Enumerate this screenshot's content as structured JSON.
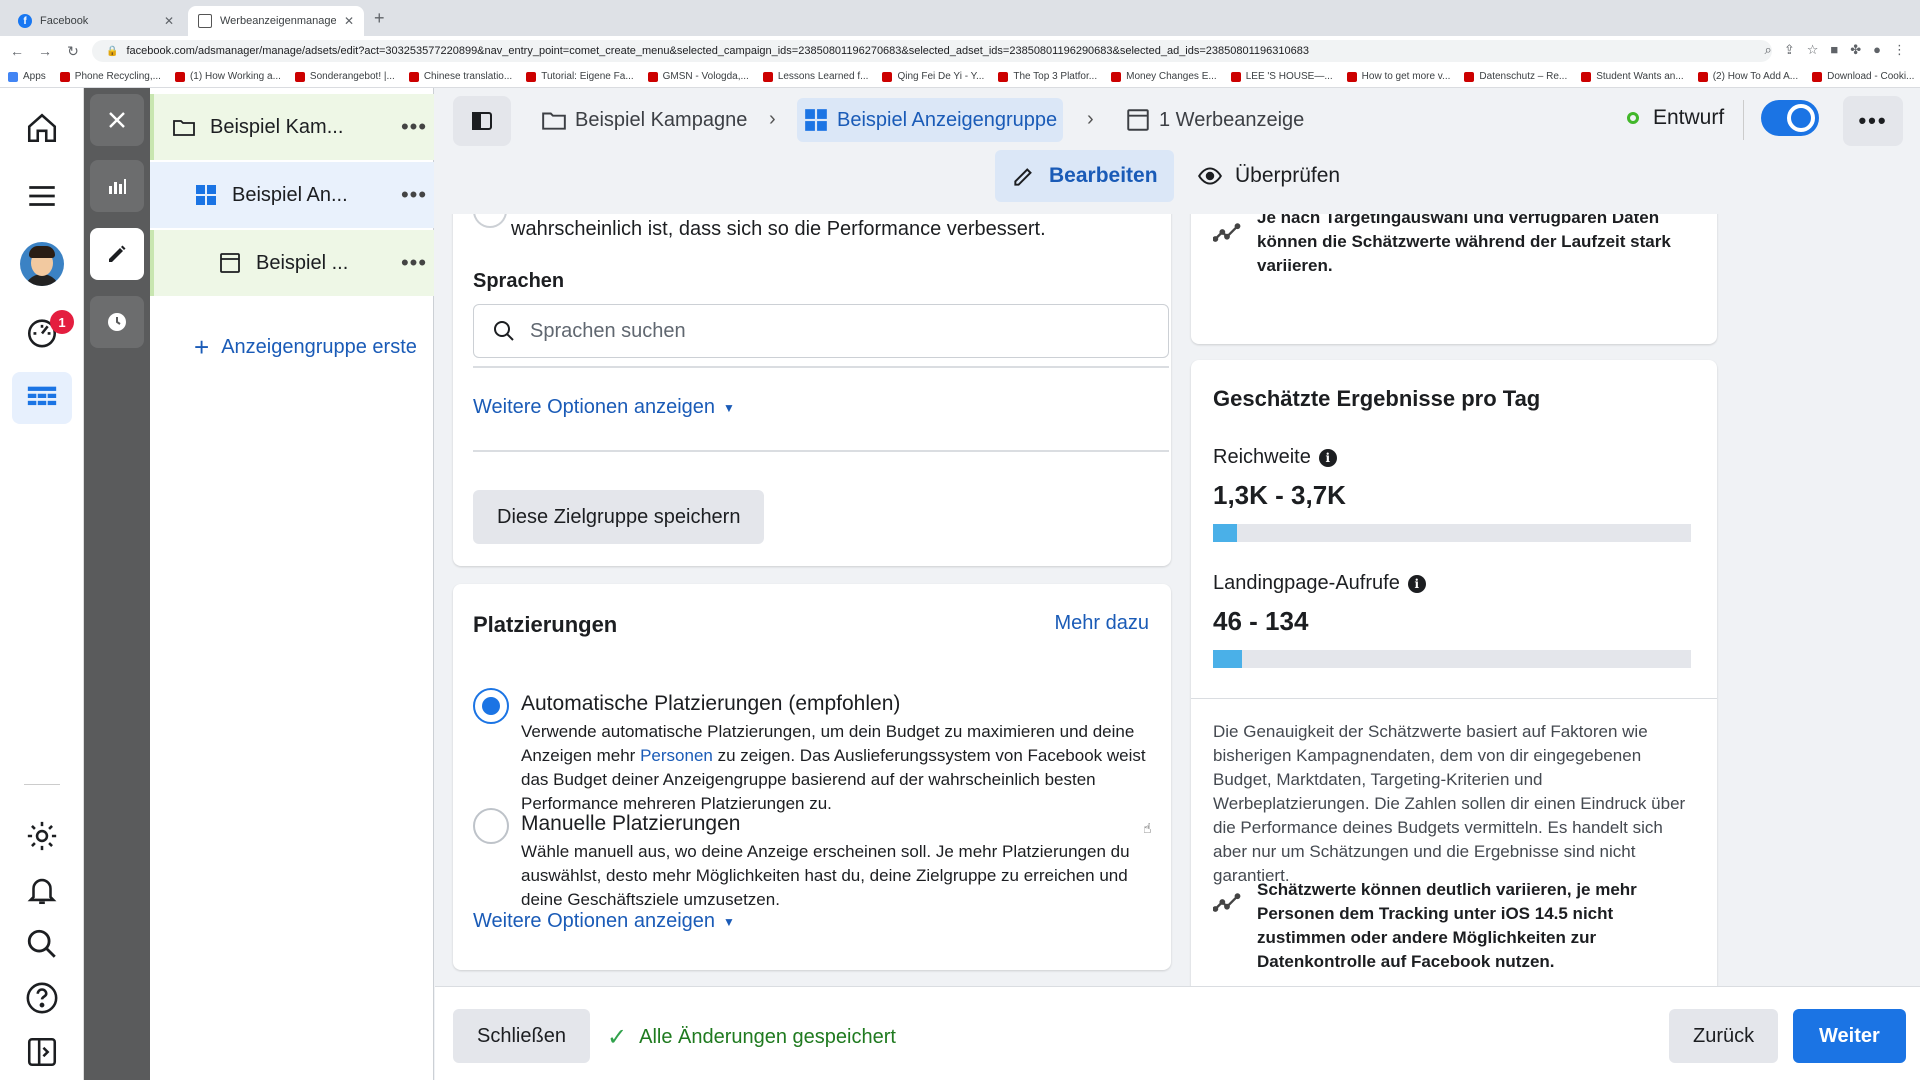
{
  "browser": {
    "tabs": [
      {
        "title": "Facebook",
        "active": false
      },
      {
        "title": "Werbeanzeigenmanager - Wer",
        "active": true
      }
    ],
    "url": "facebook.com/adsmanager/manage/adsets/edit?act=303253577220899&nav_entry_point=comet_create_menu&selected_campaign_ids=23850801196270683&selected_adset_ids=23850801196290683&selected_ad_ids=23850801196310683",
    "bookmarks": [
      "Apps",
      "Phone Recycling,...",
      "(1) How Working a...",
      "Sonderangebot! |...",
      "Chinese translatio...",
      "Tutorial: Eigene Fa...",
      "GMSN - Vologda,...",
      "Lessons Learned f...",
      "Qing Fei De Yi - Y...",
      "The Top 3 Platfor...",
      "Money Changes E...",
      "LEE 'S HOUSE—...",
      "How to get more v...",
      "Datenschutz – Re...",
      "Student Wants an...",
      "(2) How To Add A...",
      "Download - Cooki..."
    ]
  },
  "rail": {
    "notification_count": "1"
  },
  "tree": {
    "campaign": "Beispiel Kam...",
    "adset": "Beispiel An...",
    "ad": "Beispiel ...",
    "more": "•••",
    "create_adset": "Anzeigengruppe erste"
  },
  "topbar": {
    "crumb_campaign": "Beispiel Kampagne",
    "crumb_adset": "Beispiel Anzeigengruppe",
    "crumb_ad": "1 Werbeanzeige",
    "status": "Entwurf",
    "edit": "Bearbeiten",
    "review": "Überprüfen"
  },
  "audience": {
    "cut_text": "wahrscheinlich ist, dass sich so die Performance verbessert.",
    "languages_heading": "Sprachen",
    "languages_placeholder": "Sprachen suchen",
    "more_options": "Weitere Optionen anzeigen",
    "save_audience": "Diese Zielgruppe speichern"
  },
  "placements": {
    "heading": "Platzierungen",
    "learn_more": "Mehr dazu",
    "auto_title": "Automatische Platzierungen (empfohlen)",
    "auto_desc_1": "Verwende automatische Platzierungen, um dein Budget zu maximieren und deine Anzeigen mehr",
    "auto_desc_link": "Personen",
    "auto_desc_2": " zu zeigen. Das Auslieferungssystem von Facebook weist das Budget deiner Anzeigengruppe basierend auf der wahrscheinlich besten Performance mehreren Platzierungen zu.",
    "manual_title": "Manuelle Platzierungen",
    "manual_desc": "Wähle manuell aus, wo deine Anzeige erscheinen soll. Je mehr Platzierungen du auswählst, desto mehr Möglichkeiten hast du, deine Zielgruppe zu erreichen und deine Geschäftsziele umzusetzen.",
    "more_options": "Weitere Optionen anzeigen",
    "selected": "auto"
  },
  "side": {
    "cut_text": "Je nach Targetingauswahl und verfügbaren Daten können die Schätzwerte während der Laufzeit stark variieren.",
    "estimates_heading": "Geschätzte Ergebnisse pro Tag",
    "reach_label": "Reichweite",
    "reach_value": "1,3K - 3,7K",
    "reach_fill": 0.05,
    "lpv_label": "Landingpage-Aufrufe",
    "lpv_value": "46 - 134",
    "lpv_fill": 0.06,
    "accuracy_text": "Die Genauigkeit der Schätzwerte basiert auf Faktoren wie bisherigen Kampagnendaten, dem von dir eingegebenen Budget, Marktdaten, Targeting-Kriterien und Werbeplatzierungen. Die Zahlen sollen dir einen Eindruck über die Performance deines Budgets vermitteln. Es handelt sich aber nur um Schätzungen und die Ergebnisse sind nicht garantiert.",
    "ios_text": "Schätzwerte können deutlich variieren, je mehr Personen dem Tracking unter iOS 14.5 nicht zustimmen oder andere Möglichkeiten zur Datenkontrolle auf Facebook nutzen."
  },
  "footer": {
    "close": "Schließen",
    "saved": "Alle Änderungen gespeichert",
    "back": "Zurück",
    "next": "Weiter"
  },
  "colors": {
    "primary": "#1b74e4",
    "link": "#1a5bb7",
    "success": "#31a24c",
    "bar_fill": "#4ab0e8"
  }
}
